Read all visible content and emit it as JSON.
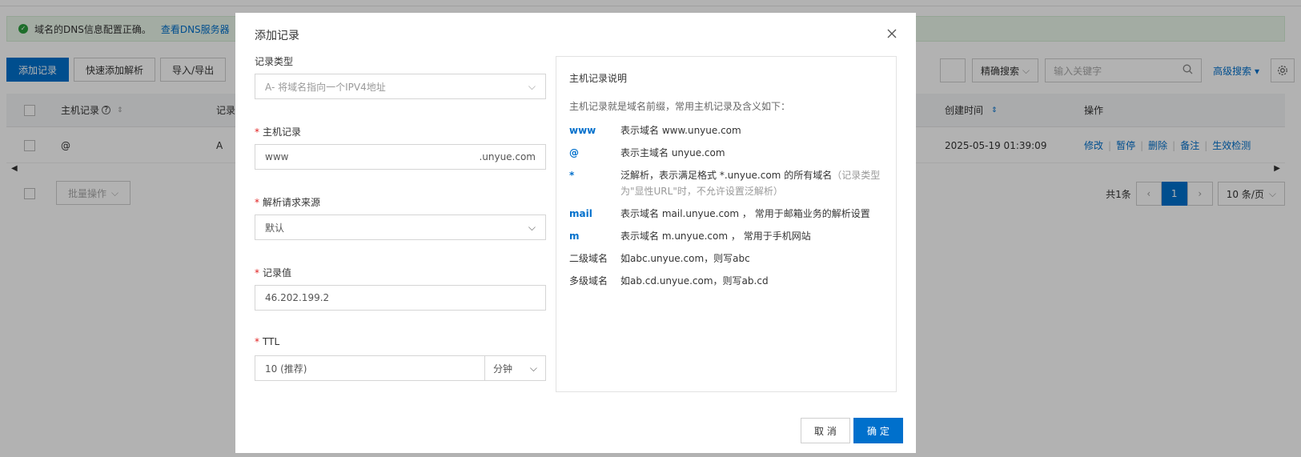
{
  "alert": {
    "text": "域名的DNS信息配置正确。",
    "link": "查看DNS服务器"
  },
  "toolbar": {
    "add": "添加记录",
    "quick_add": "快速添加解析",
    "import_export": "导入/导出"
  },
  "filters": {
    "exact_search": "精确搜索",
    "keyword_placeholder": "输入关键字",
    "advanced": "高级搜索"
  },
  "table": {
    "col_host": "主机记录",
    "col_type": "记录",
    "col_created": "创建时间",
    "col_ops": "操作",
    "row": {
      "host": "@",
      "type": "A",
      "created": "2025-05-19 01:39:09"
    },
    "ops": [
      "修改",
      "暂停",
      "删除",
      "备注",
      "生效检测"
    ]
  },
  "footer": {
    "batch": "批量操作",
    "total": "共1条",
    "page": "1",
    "page_size": "10 条/页"
  },
  "modal": {
    "title": "添加记录",
    "record_type_label": "记录类型",
    "record_type_value": "A- 将域名指向一个IPV4地址",
    "host_label": "主机记录",
    "host_value": "www",
    "host_suffix": ".unyue.com",
    "source_label": "解析请求来源",
    "source_value": "默认",
    "value_label": "记录值",
    "value_value": "46.202.199.2",
    "ttl_label": "TTL",
    "ttl_value": "10 (推荐)",
    "ttl_unit": "分钟",
    "cancel": "取 消",
    "confirm": "确 定"
  },
  "help": {
    "title": "主机记录说明",
    "intro": "主机记录就是域名前缀，常用主机记录及含义如下：",
    "rows": [
      {
        "key": "www",
        "desc": "表示域名 www.unyue.com"
      },
      {
        "key": "@",
        "desc": "表示主域名 unyue.com"
      },
      {
        "key": "*",
        "desc": "泛解析，表示满足格式 *.unyue.com 的所有域名",
        "note": "（记录类型为\"显性URL\"时，不允许设置泛解析）"
      },
      {
        "key": "mail",
        "desc": "表示域名 mail.unyue.com ， 常用于邮箱业务的解析设置"
      },
      {
        "key": "m",
        "desc": "表示域名 m.unyue.com ， 常用于手机网站"
      },
      {
        "key": "二级域名",
        "desc": "如abc.unyue.com，则写abc"
      },
      {
        "key": "多级域名",
        "desc": "如ab.cd.unyue.com，则写ab.cd"
      }
    ]
  },
  "colors": {
    "primary": "#0070cc",
    "required": "#e02020",
    "success": "#2c9e3e"
  }
}
